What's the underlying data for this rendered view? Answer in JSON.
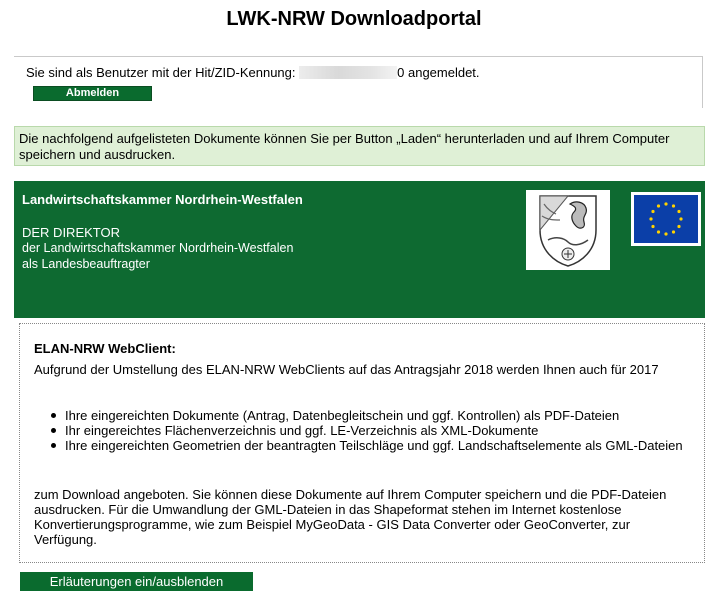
{
  "page_title": "LWK-NRW Downloadportal",
  "login": {
    "prefix": "Sie sind als Benutzer mit der Hit/ZID-Kennung:",
    "suffix": "0 angemeldet.",
    "logout_label": "Abmelden"
  },
  "info_text": "Die nachfolgend aufgelisteten Dokumente können Sie per Button „Laden“ herunterladen und auf Ihrem Computer speichern und ausdrucken.",
  "banner": {
    "organization": "Landwirtschaftskammer Nordrhein-Westfalen",
    "title": "DER DIREKTOR",
    "line1": "der Landwirtschaftskammer Nordrhein-Westfalen",
    "line2": "als Landesbeauftragter",
    "colors": {
      "banner": "#0e6a31",
      "eu_flag": "#0b3fa8",
      "eu_stars": "#ffd200"
    }
  },
  "panel": {
    "heading": "ELAN-NRW WebClient:",
    "intro": "Aufgrund der Umstellung des ELAN-NRW WebClients auf das Antragsjahr 2018 werden Ihnen auch für 2017",
    "items": [
      "Ihre eingereichten Dokumente (Antrag, Datenbegleitschein und ggf. Kontrollen) als PDF-Dateien",
      "Ihr eingereichtes Flächenverzeichnis und ggf. LE-Verzeichnis als XML-Dokumente",
      "Ihre eingereichten Geometrien der beantragten Teilschläge und ggf. Landschaftselemente als GML-Dateien"
    ],
    "outro": "zum Download angeboten. Sie können diese Dokumente auf Ihrem Computer speichern und die PDF-Dateien ausdrucken. Für die Umwandlung der GML-Dateien in das Shapeformat stehen im Internet kostenlose Konvertierungsprogramme, wie zum Beispiel MyGeoData - GIS Data Converter oder GeoConverter, zur Verfügung."
  },
  "toggle_label": "Erläuterungen ein/ausblenden"
}
